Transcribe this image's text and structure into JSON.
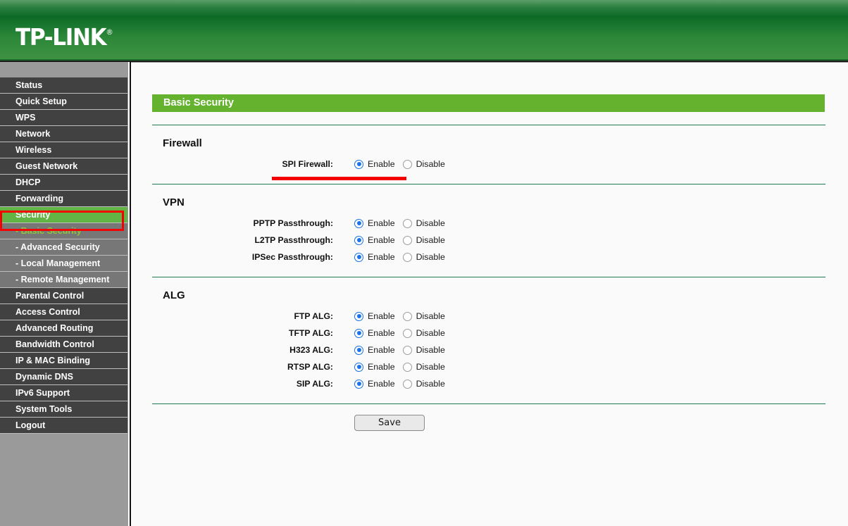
{
  "header": {
    "logo_text": "TP-LINK",
    "logo_registered": "®"
  },
  "sidebar": {
    "items": [
      {
        "label": "Status",
        "type": "main",
        "state": "normal"
      },
      {
        "label": "Quick Setup",
        "type": "main",
        "state": "normal"
      },
      {
        "label": "WPS",
        "type": "main",
        "state": "normal"
      },
      {
        "label": "Network",
        "type": "main",
        "state": "normal"
      },
      {
        "label": "Wireless",
        "type": "main",
        "state": "normal"
      },
      {
        "label": "Guest Network",
        "type": "main",
        "state": "normal"
      },
      {
        "label": "DHCP",
        "type": "main",
        "state": "normal"
      },
      {
        "label": "Forwarding",
        "type": "main",
        "state": "normal"
      },
      {
        "label": "Security",
        "type": "main",
        "state": "active-parent"
      },
      {
        "label": "- Basic Security",
        "type": "sub",
        "state": "active"
      },
      {
        "label": "- Advanced Security",
        "type": "sub",
        "state": "normal"
      },
      {
        "label": "- Local Management",
        "type": "sub",
        "state": "normal"
      },
      {
        "label": "- Remote Management",
        "type": "sub",
        "state": "normal"
      },
      {
        "label": "Parental Control",
        "type": "main",
        "state": "normal"
      },
      {
        "label": "Access Control",
        "type": "main",
        "state": "normal"
      },
      {
        "label": "Advanced Routing",
        "type": "main",
        "state": "normal"
      },
      {
        "label": "Bandwidth Control",
        "type": "main",
        "state": "normal"
      },
      {
        "label": "IP & MAC Binding",
        "type": "main",
        "state": "normal"
      },
      {
        "label": "Dynamic DNS",
        "type": "main",
        "state": "normal"
      },
      {
        "label": "IPv6 Support",
        "type": "main",
        "state": "normal"
      },
      {
        "label": "System Tools",
        "type": "main",
        "state": "normal"
      },
      {
        "label": "Logout",
        "type": "main",
        "state": "normal"
      }
    ]
  },
  "main": {
    "page_title": "Basic Security",
    "radio_options": {
      "enable": "Enable",
      "disable": "Disable"
    },
    "sections": [
      {
        "heading": "Firewall",
        "rows": [
          {
            "label": "SPI Firewall:",
            "value": "Enable"
          }
        ]
      },
      {
        "heading": "VPN",
        "rows": [
          {
            "label": "PPTP Passthrough:",
            "value": "Enable"
          },
          {
            "label": "L2TP Passthrough:",
            "value": "Enable"
          },
          {
            "label": "IPSec Passthrough:",
            "value": "Enable"
          }
        ]
      },
      {
        "heading": "ALG",
        "rows": [
          {
            "label": "FTP ALG:",
            "value": "Enable"
          },
          {
            "label": "TFTP ALG:",
            "value": "Enable"
          },
          {
            "label": "H323 ALG:",
            "value": "Enable"
          },
          {
            "label": "RTSP ALG:",
            "value": "Enable"
          },
          {
            "label": "SIP ALG:",
            "value": "Enable"
          }
        ]
      }
    ],
    "save_label": "Save"
  },
  "colors": {
    "brand_green": "#65b22e",
    "header_green_dark": "#0c6a26",
    "sidebar_dark": "#414141",
    "sidebar_sub": "#777777",
    "active_green": "#62b544",
    "sub_active_text": "#8dc63f",
    "annotation_red": "#f50000",
    "radio_blue": "#1a73e8",
    "rule_green": "#1f7a4d"
  }
}
